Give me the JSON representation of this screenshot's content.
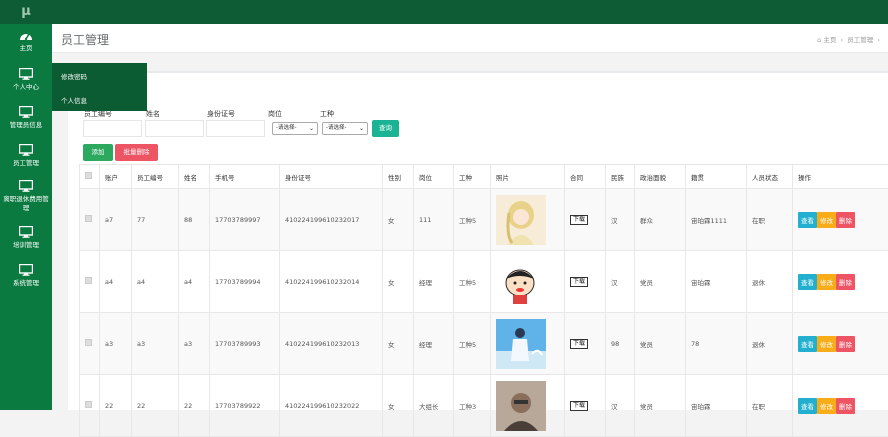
{
  "app": {
    "logo": "μ"
  },
  "sidebar": {
    "items": [
      {
        "label": "主页",
        "icon": "dashboard-icon"
      },
      {
        "label": "个人中心",
        "icon": "monitor-icon"
      },
      {
        "label": "管理员信息",
        "icon": "monitor-icon"
      },
      {
        "label": "员工管理",
        "icon": "monitor-icon"
      },
      {
        "label": "离职退休费用管理",
        "icon": "monitor-icon"
      },
      {
        "label": "培训管理",
        "icon": "monitor-icon"
      },
      {
        "label": "系统管理",
        "icon": "monitor-icon"
      }
    ],
    "flyout": [
      "修改密码",
      "个人信息"
    ]
  },
  "header": {
    "title": "员工管理",
    "breadcrumb_home": "主页",
    "breadcrumb_sep": "›",
    "breadcrumb_current": "员工管理",
    "breadcrumb_more": "›"
  },
  "search": {
    "labels": [
      "员工编号",
      "姓名",
      "身份证号",
      "岗位",
      "工种"
    ],
    "post_select": "-请选择-",
    "type_select": "-请选择-",
    "query_button": "查询"
  },
  "toolbar": {
    "add": "添加",
    "batch_delete": "批量删除"
  },
  "table": {
    "headers": [
      "账户",
      "员工编号",
      "姓名",
      "手机号",
      "身份证号",
      "性别",
      "岗位",
      "工种",
      "照片",
      "合同",
      "民族",
      "政治面貌",
      "籍贯",
      "人员状态",
      "操作"
    ],
    "download_label": "下载",
    "actions": {
      "view": "查看",
      "edit": "修改",
      "delete": "删除"
    },
    "rows": [
      {
        "account": "a7",
        "emp_no": "77",
        "name": "88",
        "phone": "17703789997",
        "id_card": "410224199610232017",
        "gender": "女",
        "post": "111",
        "type": "工种5",
        "nation": "汉",
        "political": "群众",
        "native": "宙珀霖1111",
        "status": "在职"
      },
      {
        "account": "a4",
        "emp_no": "a4",
        "name": "a4",
        "phone": "17703789994",
        "id_card": "410224199610232014",
        "gender": "女",
        "post": "经理",
        "type": "工种5",
        "nation": "汉",
        "political": "党员",
        "native": "宙珀霖",
        "status": "退休"
      },
      {
        "account": "a3",
        "emp_no": "a3",
        "name": "a3",
        "phone": "17703789993",
        "id_card": "410224199610232013",
        "gender": "女",
        "post": "经理",
        "type": "工种5",
        "nation": "98",
        "political": "党员",
        "native": "78",
        "status": "退休"
      },
      {
        "account": "22",
        "emp_no": "22",
        "name": "22",
        "phone": "17703789922",
        "id_card": "410224199610232022",
        "gender": "女",
        "post": "大组长",
        "type": "工种3",
        "nation": "汉",
        "political": "党员",
        "native": "宙珀霖",
        "status": "在职"
      }
    ]
  },
  "colors": {
    "topbar": "#0e5c35",
    "sidebar": "#0a7a40",
    "flyout": "#0b5c33",
    "add": "#2ca85f",
    "delete": "#ed5565",
    "view": "#23b0d0",
    "edit": "#f8ac18"
  }
}
